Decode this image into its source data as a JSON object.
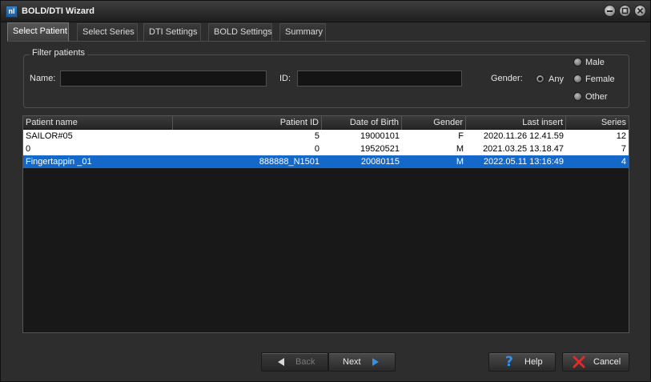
{
  "window": {
    "title": "BOLD/DTI Wizard",
    "icon_text": "nI"
  },
  "tabs": [
    {
      "label": "Select Patient",
      "active": true
    },
    {
      "label": "Select Series",
      "active": false
    },
    {
      "label": "DTI Settings",
      "active": false
    },
    {
      "label": "BOLD Settings",
      "active": false
    },
    {
      "label": "Summary",
      "active": false
    }
  ],
  "filter": {
    "title": "Filter patients",
    "name_label": "Name:",
    "name_value": "",
    "id_label": "ID:",
    "id_value": "",
    "gender_label": "Gender:",
    "gender_options": [
      "Any",
      "Male",
      "Female",
      "Other"
    ],
    "gender_selected": "Any"
  },
  "table": {
    "columns": [
      "Patient name",
      "Patient ID",
      "Date of Birth",
      "Gender",
      "Last insert",
      "Series"
    ],
    "rows": [
      [
        "SAILOR#05",
        "5",
        "19000101",
        "F",
        "2020.11.26 12.41.59",
        "12"
      ],
      [
        "0",
        "0",
        "19520521",
        "M",
        "2021.03.25 13.18.47",
        "7"
      ],
      [
        "Fingertappin _01",
        "888888_N1501",
        "20080115",
        "M",
        "2022.05.11 13:16:49",
        "4"
      ]
    ],
    "selected_row": 2
  },
  "buttons": {
    "back": "Back",
    "next": "Next",
    "help": "Help",
    "cancel": "Cancel"
  },
  "colors": {
    "selection": "#1468c9",
    "background": "#2d2d2d"
  }
}
